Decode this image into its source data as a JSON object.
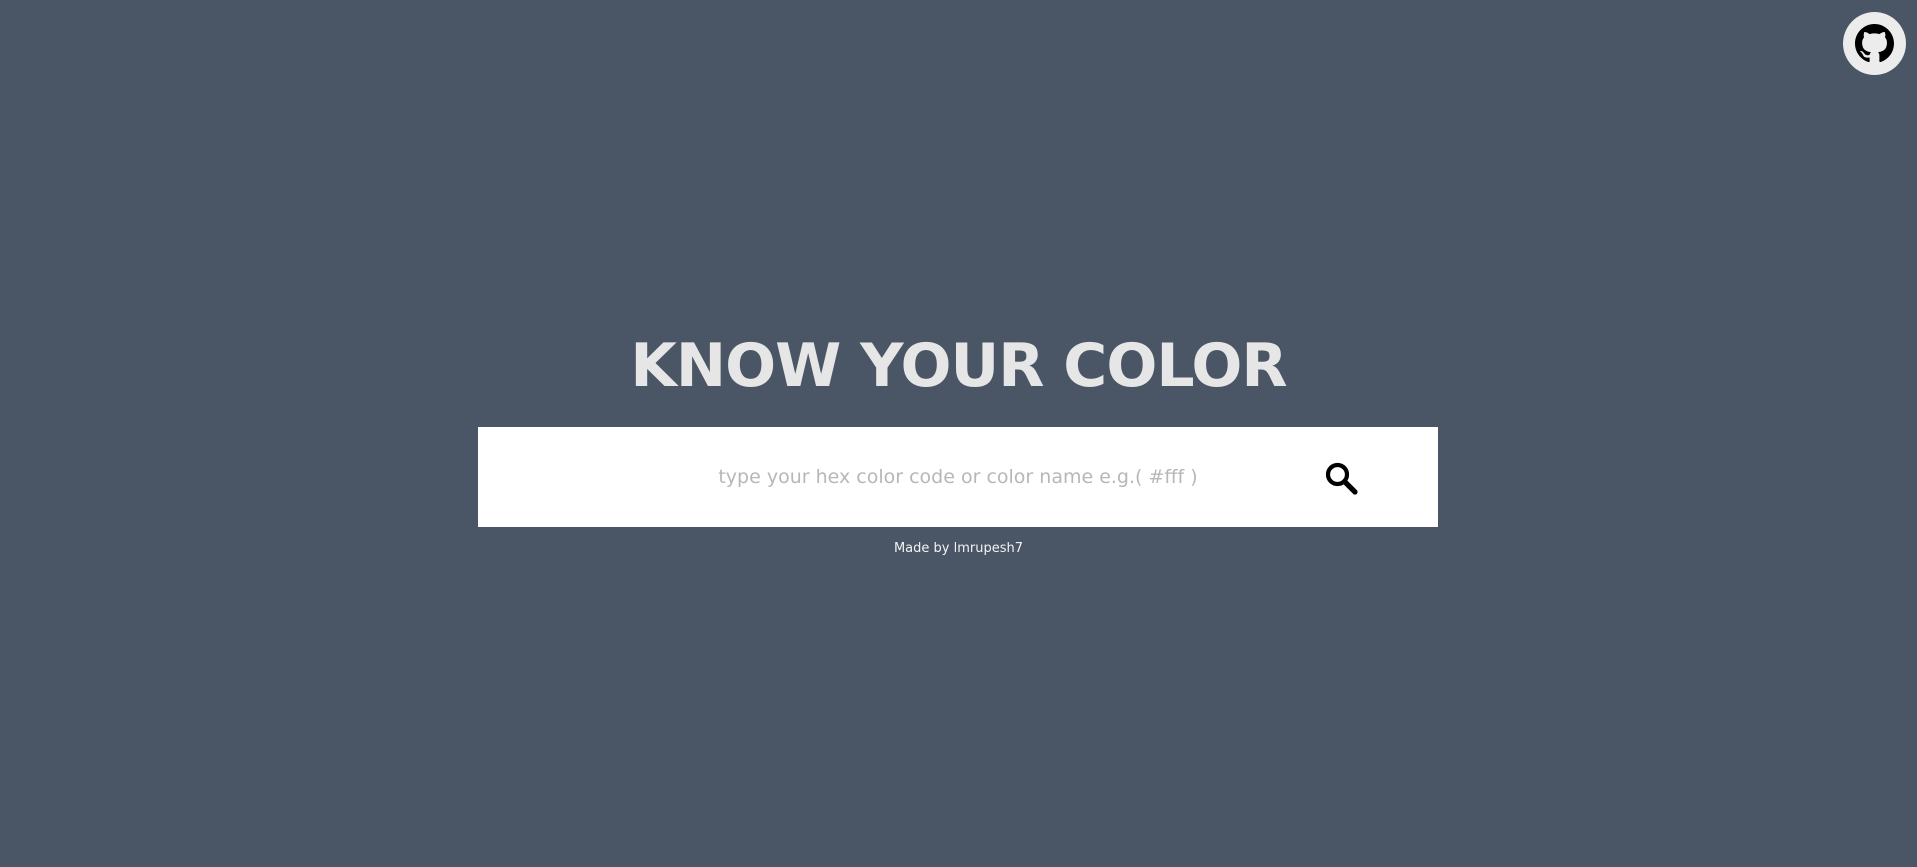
{
  "header": {
    "github_icon": "github-icon"
  },
  "main": {
    "title": "KNOW YOUR COLOR",
    "search": {
      "placeholder": "type your hex color code or color name e.g.( #fff )",
      "value": "",
      "button_icon": "search-icon"
    }
  },
  "footer": {
    "credit": "Made by lmrupesh7"
  },
  "colors": {
    "background": "#4a5565",
    "title": "#e6e6e6",
    "search_box": "#ffffff",
    "placeholder": "#b7b7b7",
    "icon": "#000000"
  }
}
